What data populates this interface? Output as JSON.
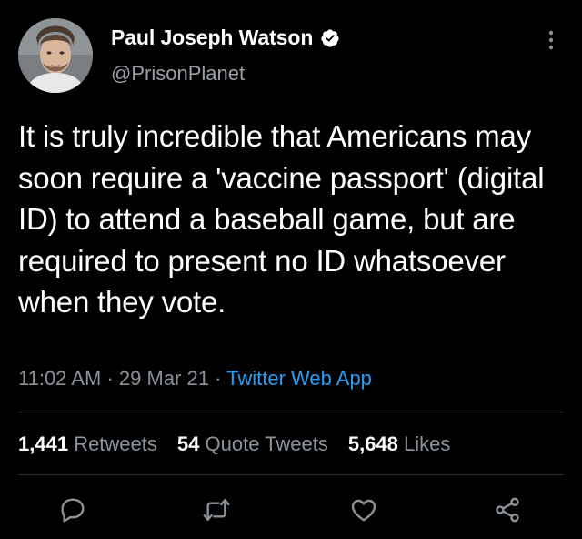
{
  "user": {
    "display_name": "Paul Joseph Watson",
    "handle": "@PrisonPlanet",
    "verified_icon": "verified-badge-icon"
  },
  "tweet": {
    "text": "It is truly incredible that Americans may soon require a 'vaccine passport' (digital ID) to attend a baseball game, but are required to present no ID whatsoever when they vote.",
    "time": "11:02 AM",
    "date": "29 Mar 21",
    "separator": "·",
    "source": "Twitter Web App"
  },
  "stats": {
    "retweets": {
      "count": "1,441",
      "label": "Retweets"
    },
    "quote_tweets": {
      "count": "54",
      "label": "Quote Tweets"
    },
    "likes": {
      "count": "5,648",
      "label": "Likes"
    }
  },
  "actions": [
    "reply-icon",
    "retweet-icon",
    "like-icon",
    "share-icon"
  ],
  "colors": {
    "background": "#000000",
    "text": "#ffffff",
    "secondary": "#8b9299",
    "link": "#2c9bf0",
    "divider": "#2f3336"
  }
}
